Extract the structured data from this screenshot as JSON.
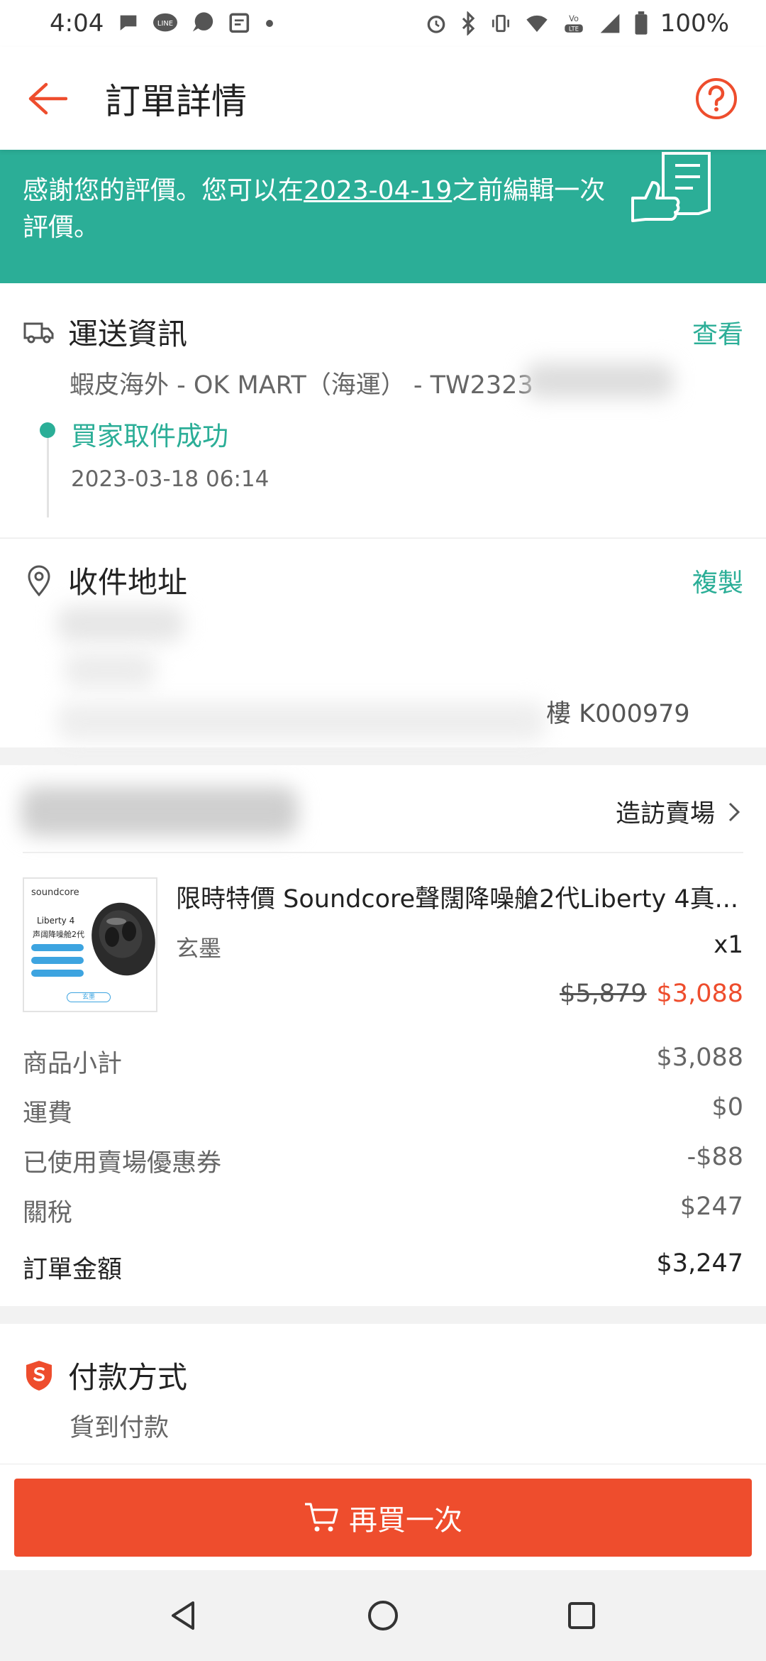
{
  "status_bar": {
    "time": "4:04",
    "battery": "100%",
    "icons": [
      "chat-bubble-icon",
      "line-icon",
      "messenger-icon",
      "news-icon",
      "dot-icon",
      "alarm-icon",
      "bluetooth-icon",
      "vibrate-icon",
      "wifi-icon",
      "volte-icon",
      "signal-icon",
      "battery-icon"
    ]
  },
  "app_bar": {
    "title": "訂單詳情"
  },
  "banner": {
    "text_before": "感謝您的評價。您可以在",
    "date": "2023-04-19",
    "text_after": "之前編輯一次評價。"
  },
  "shipping": {
    "title": "運送資訊",
    "action": "查看",
    "carrier": "蝦皮海外 - OK MART（海運） - TW2323",
    "status": "買家取件成功",
    "timestamp": "2023-03-18 06:14"
  },
  "address": {
    "title": "收件地址",
    "action": "複製",
    "line_visible": "樓 K000979"
  },
  "order": {
    "shop_action": "造訪賣場",
    "product": {
      "name": "限時特價 Soundcore聲闊降噪艙2代Liberty 4真...",
      "variant": "玄墨",
      "quantity": "x1",
      "original_price": "$5,879",
      "price": "$3,088",
      "thumb_brand": "soundcore",
      "thumb_title": "Liberty 4",
      "thumb_subtitle": "声阔降噪舱2代",
      "thumb_color": "玄墨"
    },
    "summary": [
      {
        "label": "商品小計",
        "value": "$3,088"
      },
      {
        "label": "運費",
        "value": "$0"
      },
      {
        "label": "已使用賣場優惠券",
        "value": "-$88"
      },
      {
        "label": "關稅",
        "value": "$247"
      }
    ],
    "total_label": "訂單金額",
    "total_value": "$3,247"
  },
  "payment": {
    "title": "付款方式",
    "method": "貨到付款"
  },
  "bottom": {
    "buy_again": "再買一次"
  },
  "colors": {
    "accent": "#ee4d2d",
    "teal": "#2bae97"
  }
}
